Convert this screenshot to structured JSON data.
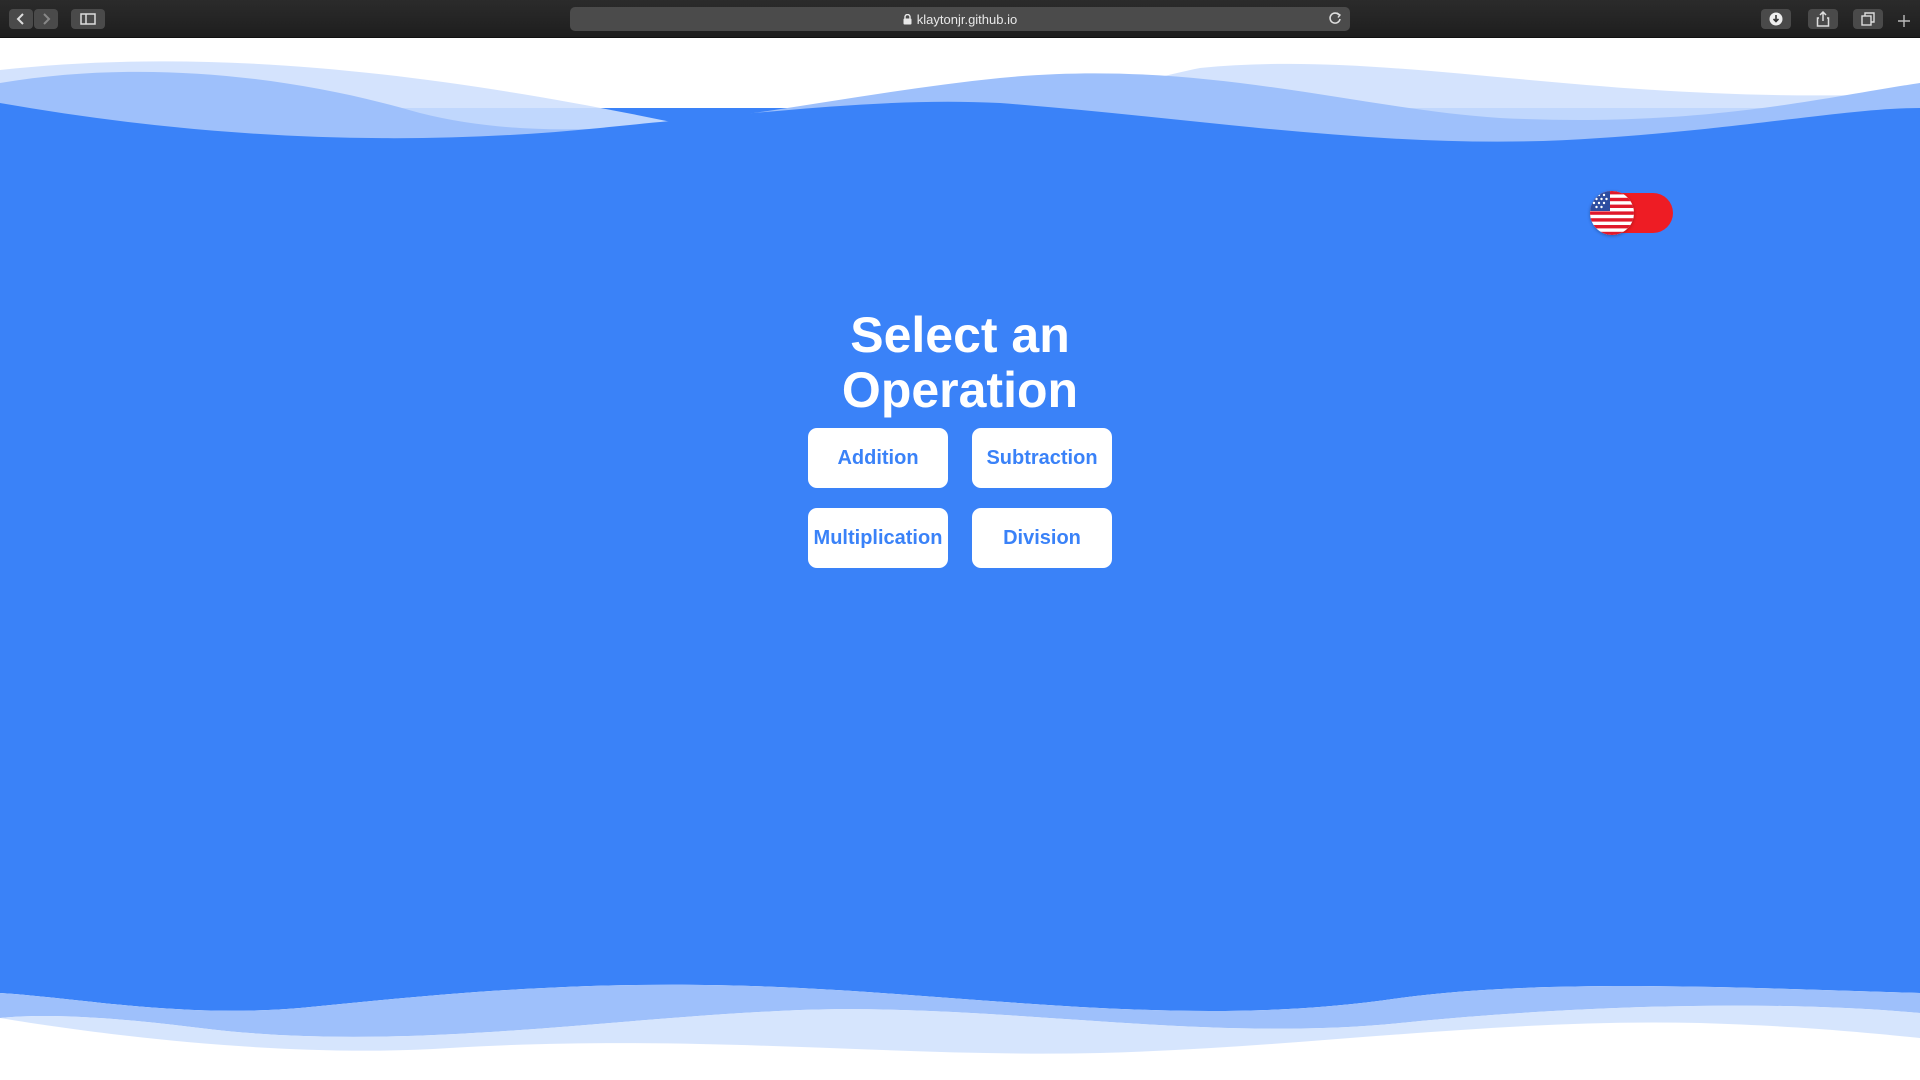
{
  "browser": {
    "url": "klaytonjr.github.io",
    "icons": [
      "back-icon",
      "forward-icon",
      "sidebar-icon",
      "lock-icon",
      "reload-icon",
      "download-icon",
      "share-icon",
      "tabs-icon",
      "new-tab-icon"
    ]
  },
  "page": {
    "title_line1": "Select an",
    "title_line2": "Operation",
    "language_toggle": {
      "flag": "us-flag-icon",
      "color": "#ee1c24"
    },
    "operations": [
      {
        "label": "Addition"
      },
      {
        "label": "Subtraction"
      },
      {
        "label": "Multiplication"
      },
      {
        "label": "Division"
      }
    ]
  },
  "colors": {
    "background_blue": "#3a82f8",
    "button_bg": "#ffffff",
    "button_text": "#3a82f8",
    "toggle_red": "#ee1c24"
  }
}
